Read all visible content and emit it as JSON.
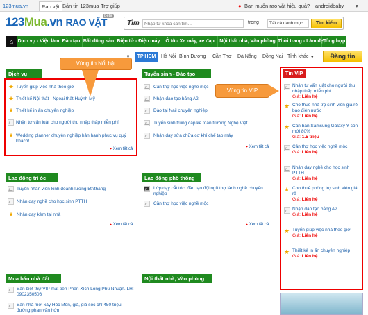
{
  "topbar": {
    "logo": "123mua.vn",
    "tabs": [
      "Rao vặt",
      "Bản tin 123mua",
      "Trợ giúp"
    ],
    "notify": "Bạn muốn rao vặt hiệu quả?",
    "user": "androidbaby"
  },
  "header": {
    "logo_a": "123",
    "logo_b": "Mua",
    "logo_c": ".vn",
    "section": "RAO VẶT",
    "beta": "beta"
  },
  "search": {
    "label": "Tìm",
    "placeholder": "Nhập từ khóa cần tìm...",
    "in_label": "trong",
    "category": "Tất cả danh mục",
    "button": "Tìm kiếm"
  },
  "nav": [
    "Dịch vụ - Việc làm",
    "Đào tạo",
    "Bất động sản",
    "Điện tử - Điện máy",
    "Ô tô - Xe máy, xe đạp",
    "Nội thất nhà, Văn phòng",
    "Thời trang - Làm đẹp",
    "Tổng hợp"
  ],
  "cities": {
    "active": "TP HCM",
    "list": [
      "Hà Nội",
      "Bình Dương",
      "Cần Thơ",
      "Đà Nẵng",
      "Đồng Nai",
      "Tỉnh khác"
    ],
    "post_button": "Đăng tin"
  },
  "callouts": {
    "noibat": "Vùng tin Nổi bật",
    "vip": "Vùng tin VIP"
  },
  "dichvu": {
    "title": "Dịch vụ",
    "items": [
      "Tuyển giúp việc nhà theo giờ",
      "Thiết kế Nội thất - Ngoại thất Huỳnh Mỹ",
      "Thiết kế in ấn chuyên nghiệp",
      "Nhận tư vấn luật cho người thu nhập thấp miễn phí",
      "Wedding planner chuyên nghiệp hân hạnh phục vụ quý khách!"
    ],
    "more": "Xem tất cả"
  },
  "tuyensinh": {
    "title": "Tuyển sinh - Đào tạo",
    "items": [
      "Cần thợ học việc nghề mộc",
      "Nhận đào tạo bằng A2",
      "Đào tại Nail chuyên nghiệp",
      "Tuyển sinh trung cấp kế toán trường Nghệ Việt",
      "Nhận dạy sửa chữa cơ khí chế tạo máy"
    ],
    "more": "Xem tất cả"
  },
  "laodongtrioc": {
    "title": "Lao động trí óc",
    "items": [
      "Tuyển nhân viên kinh doanh lương 5tr/tháng",
      "Nhận dạy nghề cho học sinh PTTH",
      "Nhận dạy kèm tại nhà"
    ],
    "more": "Xem tất cả"
  },
  "laodongphothong": {
    "title": "Lao động phổ thông",
    "items": [
      "Lớp dạy cắt tóc, đào tạo đội ngũ thợ lành nghề chuyên nghiệp",
      "Cần thợ học việc nghề mộc"
    ],
    "more": "Xem tất cả"
  },
  "muaban": {
    "title": "Mua bán nhà đất",
    "items": [
      "Bán biệt thự VIP mặt tiền Phan Xích Long Phú Nhuận. LH: 0902350506",
      "Bán nhà mới xây Hóc Môn, giá, giá sốc chỉ 450 triệu đường phan văn hớn"
    ]
  },
  "noithat": {
    "title": "Nội thất nhà, Văn phòng"
  },
  "vip": {
    "title": "Tin VIP",
    "price_label": "Giá:",
    "items": [
      {
        "t": "Nhận tư vấn luật cho người thu nhập thấp miễn phí",
        "p": "Liên hệ"
      },
      {
        "t": "Cho thuê nhà trọ sinh viên giá rẻ bao điện nước",
        "p": "Liên hệ"
      },
      {
        "t": "Cần bán Samsung Galaxy Y còn mới 80%",
        "p": "1.5 triệu"
      },
      {
        "t": "Cần thợ học việc nghề mộc",
        "p": "Liên hệ"
      },
      {
        "t": "Nhận dạy nghề cho học sinh PTTH",
        "p": "Liên hệ"
      },
      {
        "t": "Cho thuê phòng trọ sinh viên giá rẻ",
        "p": "Liên hệ"
      },
      {
        "t": "Nhận đào tạo bằng A2",
        "p": "Liên hệ"
      },
      {
        "t": "Tuyển giúp việc nhà theo giờ",
        "p": "Liên hệ"
      },
      {
        "t": "Thiết kế in ấn chuyên nghiệp",
        "p": "Liên hệ"
      }
    ]
  }
}
